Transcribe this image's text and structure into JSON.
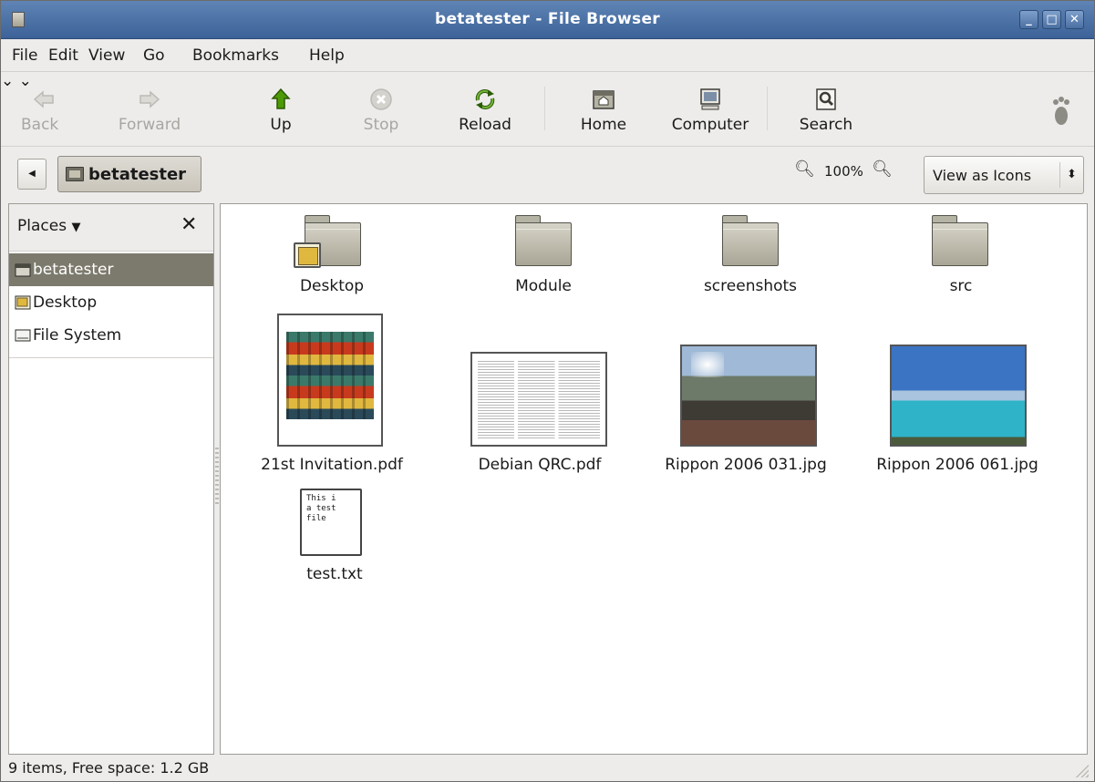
{
  "window": {
    "title": "betatester - File Browser"
  },
  "menu": [
    {
      "label": "File"
    },
    {
      "label": "Edit"
    },
    {
      "label": "View"
    },
    {
      "label": "Go"
    },
    {
      "label": "Bookmarks"
    },
    {
      "label": "Help"
    }
  ],
  "toolbar": {
    "back": {
      "label": "Back",
      "icon": "left-arrow-icon",
      "enabled": false
    },
    "forward": {
      "label": "Forward",
      "icon": "right-arrow-icon",
      "enabled": false
    },
    "up": {
      "label": "Up",
      "icon": "up-arrow-icon"
    },
    "stop": {
      "label": "Stop",
      "icon": "stop-icon",
      "enabled": false
    },
    "reload": {
      "label": "Reload",
      "icon": "reload-icon"
    },
    "home": {
      "label": "Home",
      "icon": "home-icon"
    },
    "computer": {
      "label": "Computer",
      "icon": "computer-icon"
    },
    "search": {
      "label": "Search",
      "icon": "search-icon"
    }
  },
  "location": {
    "current": "betatester",
    "zoom": "100%",
    "view_mode": "View as Icons"
  },
  "sidebar": {
    "header": "Places",
    "items": [
      {
        "label": "betatester",
        "icon": "home-folder-icon",
        "selected": true
      },
      {
        "label": "Desktop",
        "icon": "desktop-icon"
      },
      {
        "label": "File System",
        "icon": "drive-icon"
      }
    ]
  },
  "files": [
    {
      "name": "Desktop",
      "type": "folder"
    },
    {
      "name": "Module",
      "type": "folder"
    },
    {
      "name": "screenshots",
      "type": "folder"
    },
    {
      "name": "src",
      "type": "folder"
    },
    {
      "name": "21st Invitation.pdf",
      "type": "pdf-thumbnail"
    },
    {
      "name": "Debian QRC.pdf",
      "type": "pdf-thumbnail"
    },
    {
      "name": "Rippon 2006 031.jpg",
      "type": "image-thumbnail"
    },
    {
      "name": "Rippon 2006 061.jpg",
      "type": "image-thumbnail"
    },
    {
      "name": "test.txt",
      "type": "text",
      "preview": "This is a test file"
    }
  ],
  "status": {
    "text": "9 items, Free space: 1.2 GB"
  },
  "colors": {
    "titlebar": "#4a6fa3",
    "selection": "#7c7a6d",
    "window_bg": "#edeceb"
  }
}
